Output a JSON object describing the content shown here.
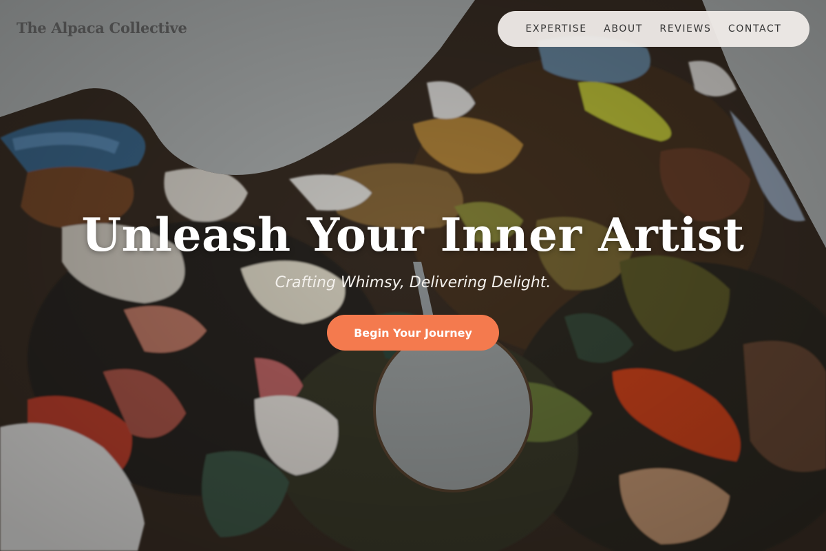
{
  "header": {
    "brand": "The Alpaca Collective"
  },
  "nav": {
    "items": [
      {
        "label": "EXPERTISE"
      },
      {
        "label": "ABOUT"
      },
      {
        "label": "REVIEWS"
      },
      {
        "label": "CONTACT"
      }
    ]
  },
  "hero": {
    "headline": "Unleash Your Inner Artist",
    "tagline": "Crafting Whimsy, Delivering Delight.",
    "cta_label": "Begin Your Journey",
    "background_image": "painted-artist-palette"
  },
  "colors": {
    "cta_background": "#f47a4e",
    "nav_background": "#f0ece9",
    "page_background": "#a9adad",
    "headline_text": "#ffffff"
  }
}
